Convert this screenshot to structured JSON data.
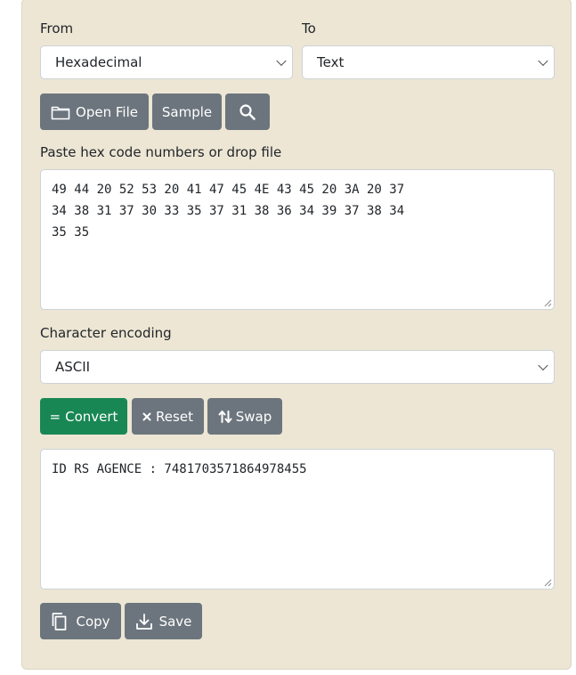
{
  "from": {
    "label": "From",
    "selected": "Hexadecimal"
  },
  "to": {
    "label": "To",
    "selected": "Text"
  },
  "toolbar": {
    "open_file_label": "Open File",
    "sample_label": "Sample",
    "search_icon": "search-icon"
  },
  "input": {
    "label": "Paste hex code numbers or drop file",
    "value": "49 44 20 52 53 20 41 47 45 4E 43 45 20 3A 20 37\n34 38 31 37 30 33 35 37 31 38 36 34 39 37 38 34\n35 35"
  },
  "encoding": {
    "label": "Character encoding",
    "selected": "ASCII"
  },
  "actions": {
    "convert_label": "Convert",
    "reset_label": "Reset",
    "swap_label": "Swap"
  },
  "output": {
    "value": "ID RS AGENCE : 7481703571864978455"
  },
  "bottom": {
    "copy_label": "Copy",
    "save_label": "Save"
  },
  "colors": {
    "panel": "#ede6d4",
    "button_gray": "#6c757d",
    "button_green": "#198754"
  }
}
